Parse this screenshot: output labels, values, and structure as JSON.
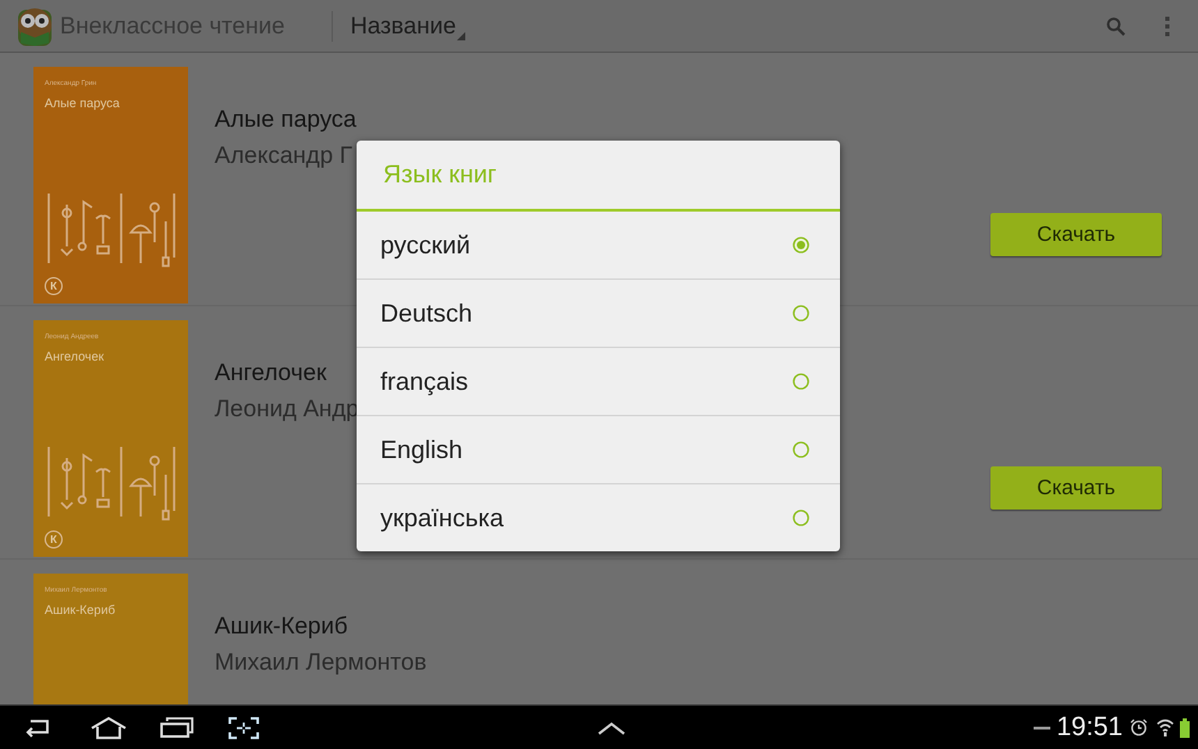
{
  "app_bar": {
    "title": "Внеклассное чтение",
    "sort": "Название"
  },
  "books": [
    {
      "title": "Алые паруса",
      "author": "Александр Г",
      "cover": {
        "author": "Александр Грин",
        "title": "Алые паруса",
        "badge": "К",
        "color": "#a8600e"
      },
      "button": "Скачать"
    },
    {
      "title": "Ангелочек",
      "author": "Леонид Андр",
      "cover": {
        "author": "Леонид Андреев",
        "title": "Ангелочек",
        "badge": "К",
        "color": "#a87410"
      },
      "button": "Скачать"
    },
    {
      "title": "Ашик-Кериб",
      "author": "Михаил Лермонтов",
      "cover": {
        "author": "Михаил Лермонтов",
        "title": "Ашик-Кериб",
        "color": "#a87812"
      }
    }
  ],
  "dialog": {
    "title": "Язык книг",
    "options": [
      {
        "label": "русский",
        "selected": true
      },
      {
        "label": "Deutsch",
        "selected": false
      },
      {
        "label": "français",
        "selected": false
      },
      {
        "label": "English",
        "selected": false
      },
      {
        "label": "українська",
        "selected": false
      }
    ]
  },
  "nav_bar": {
    "time": "19:51"
  }
}
